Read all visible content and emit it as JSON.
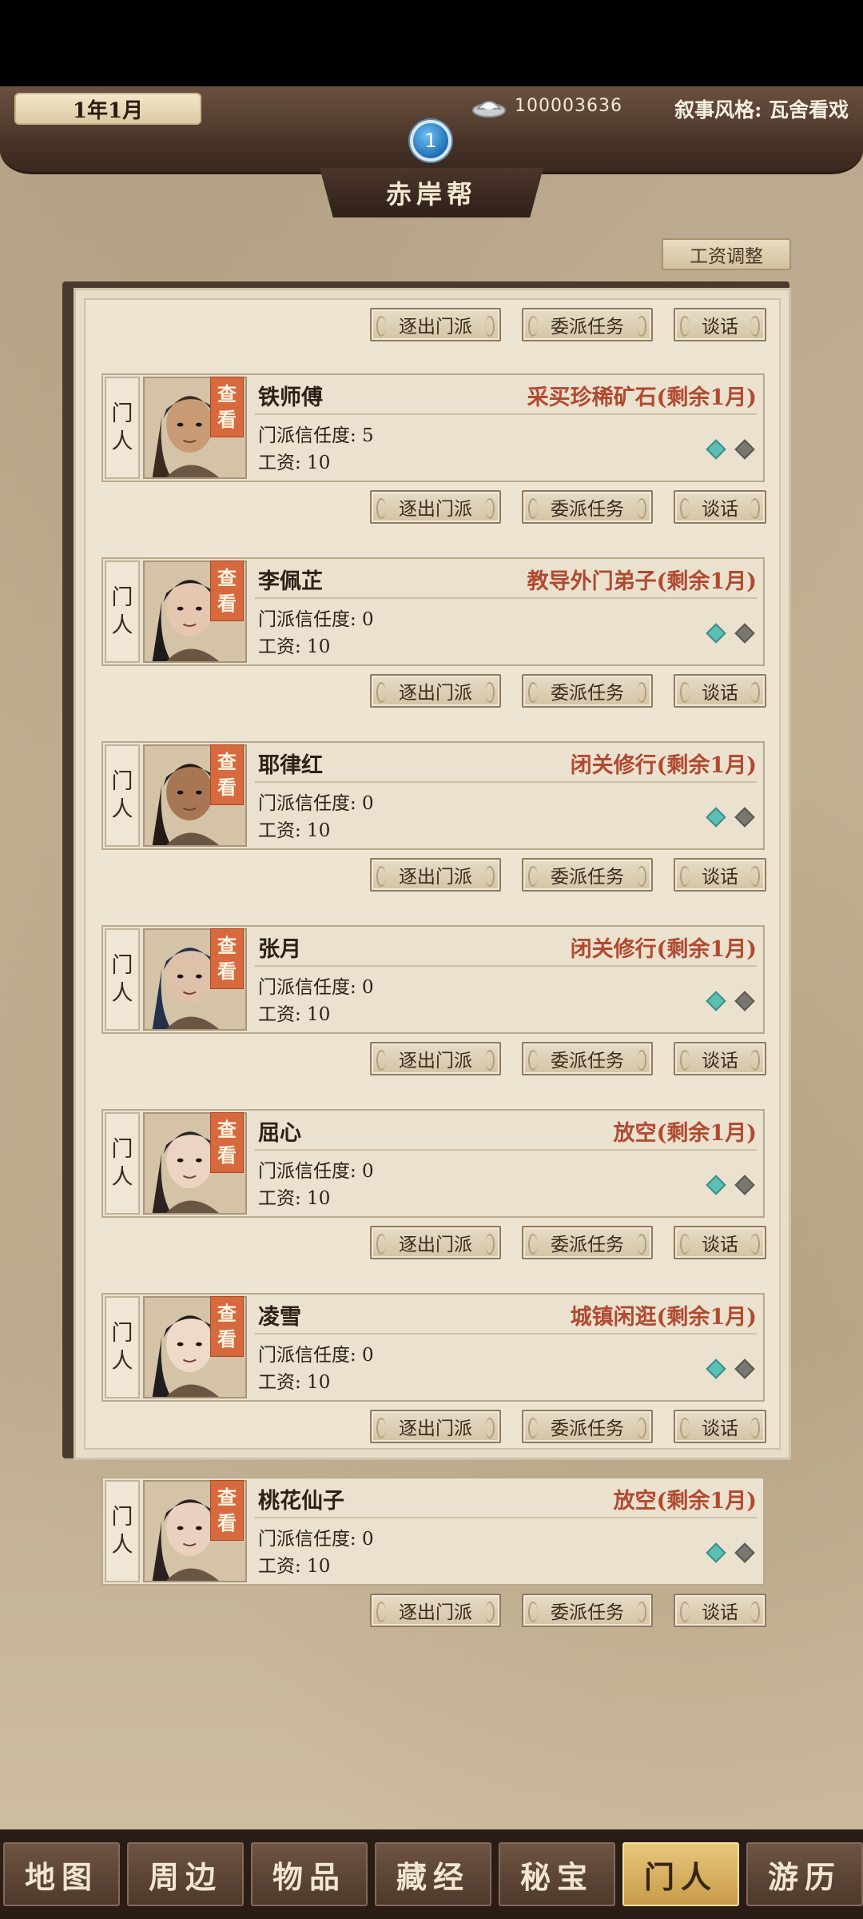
{
  "header": {
    "date": "1年1月",
    "silver_icon": "silver-ingot-icon",
    "silver_amount": "100003636",
    "narrative_style": "叙事风格: 瓦舍看戏",
    "badge": "1",
    "sect_name": "赤岸帮"
  },
  "toolbar": {
    "wage_adjust_label": "工资调整"
  },
  "actions": {
    "expel": "逐出门派",
    "assign": "委派任务",
    "talk": "谈话"
  },
  "member_tag": [
    "门",
    "人"
  ],
  "view_label": [
    "查",
    "看"
  ],
  "members": [
    {
      "name": "铁师傅",
      "task": "采买珍稀矿石(剩余1月)",
      "trust": "门派信任度: 5",
      "wage": "工资: 10"
    },
    {
      "name": "李佩芷",
      "task": "教导外门弟子(剩余1月)",
      "trust": "门派信任度: 0",
      "wage": "工资: 10"
    },
    {
      "name": "耶律红",
      "task": "闭关修行(剩余1月)",
      "trust": "门派信任度: 0",
      "wage": "工资: 10"
    },
    {
      "name": "张月",
      "task": "闭关修行(剩余1月)",
      "trust": "门派信任度: 0",
      "wage": "工资: 10"
    },
    {
      "name": "屈心",
      "task": "放空(剩余1月)",
      "trust": "门派信任度: 0",
      "wage": "工资: 10"
    },
    {
      "name": "凌雪",
      "task": "城镇闲逛(剩余1月)",
      "trust": "门派信任度: 0",
      "wage": "工资: 10"
    },
    {
      "name": "桃花仙子",
      "task": "放空(剩余1月)",
      "trust": "门派信任度: 0",
      "wage": "工资: 10"
    }
  ],
  "nav": {
    "items": [
      "地图",
      "周边",
      "物品",
      "藏经",
      "秘宝",
      "门人",
      "游历"
    ],
    "active": "门人"
  }
}
